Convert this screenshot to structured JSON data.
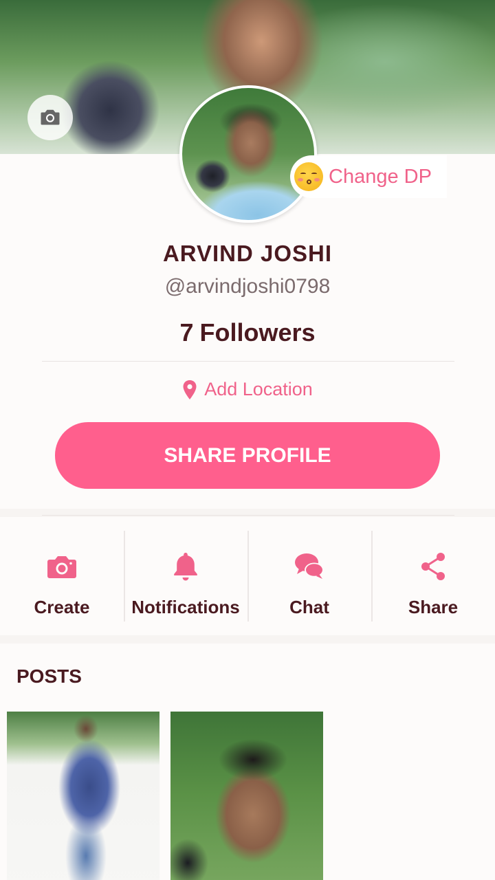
{
  "profile": {
    "name": "ARVIND JOSHI",
    "handle": "@arvindjoshi0798",
    "followers_count": "7",
    "followers_label": "Followers",
    "change_dp_label": "Change DP",
    "add_location_label": "Add Location",
    "share_profile_label": "SHARE PROFILE"
  },
  "actions": [
    {
      "label": "Create",
      "icon": "camera-icon"
    },
    {
      "label": "Notifications",
      "icon": "bell-icon"
    },
    {
      "label": "Chat",
      "icon": "chat-bubbles-icon"
    },
    {
      "label": "Share",
      "icon": "share-icon"
    }
  ],
  "posts": {
    "title": "POSTS"
  },
  "colors": {
    "accent": "#ff5f8d",
    "accent_text": "#f0628a",
    "dark_text": "#4a1a20",
    "muted_text": "#7b6b6d"
  }
}
